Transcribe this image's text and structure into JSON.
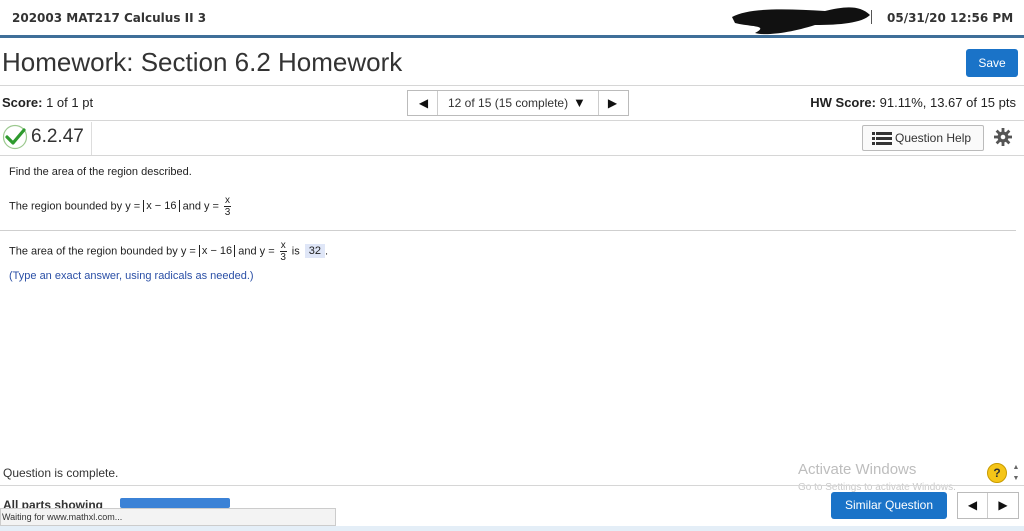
{
  "header": {
    "course": "202003 MAT217 Calculus II 3",
    "datetime": "05/31/20 12:56 PM"
  },
  "title": {
    "text": "Homework: Section 6.2 Homework",
    "save_label": "Save"
  },
  "score": {
    "label": "Score:",
    "value": "1 of 1 pt"
  },
  "navigator": {
    "selected": "12 of 15 (15 complete)",
    "prev_icon": "◀",
    "next_icon": "▶",
    "dropdown_icon": "▼"
  },
  "hw_score": {
    "label": "HW Score:",
    "value": "91.11%, 13.67 of 15 pts"
  },
  "question": {
    "number": "6.2.47",
    "help_label": "Question Help",
    "prompt": "Find the area of the region described.",
    "region_prefix": "The region bounded by y =",
    "region_abs": "x − 16",
    "region_mid": "and y =",
    "frac_num": "x",
    "frac_den": "3",
    "answer_prefix": "The area of the region bounded by y =",
    "answer_is": "is",
    "answer_value": "32",
    "answer_end": ".",
    "hint": "(Type an exact answer, using radicals as needed.)"
  },
  "footer": {
    "complete_text": "Question is complete.",
    "activate_title": "Activate Windows",
    "activate_sub": "Go to Settings to activate Windows.",
    "help_icon": "?",
    "all_parts": "All parts showing",
    "similar_label": "Similar Question",
    "prev_icon": "◀",
    "next_icon": "▶",
    "status_text": "Waiting for www.mathxl.com..."
  },
  "colors": {
    "accent": "#1a73c8",
    "header_rule": "#3f6f99",
    "hint": "#2a4fa6",
    "answer_bg": "#dfe6f7"
  }
}
